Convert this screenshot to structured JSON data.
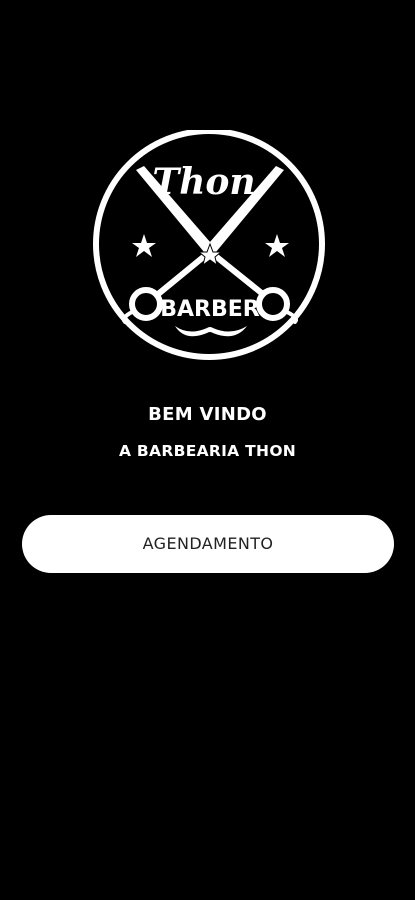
{
  "logo": {
    "icon": "barber-scissors-logo",
    "brand_script": "Thon",
    "brand_word": "BARBER",
    "colors": {
      "fg": "#ffffff",
      "bg": "#000000"
    }
  },
  "welcome": {
    "title": "BEM VINDO",
    "subtitle": "A BARBEARIA THON"
  },
  "actions": {
    "schedule_label": "AGENDAMENTO"
  },
  "theme": {
    "background": "#000000",
    "button_bg": "#ffffff",
    "button_text": "#222222"
  }
}
